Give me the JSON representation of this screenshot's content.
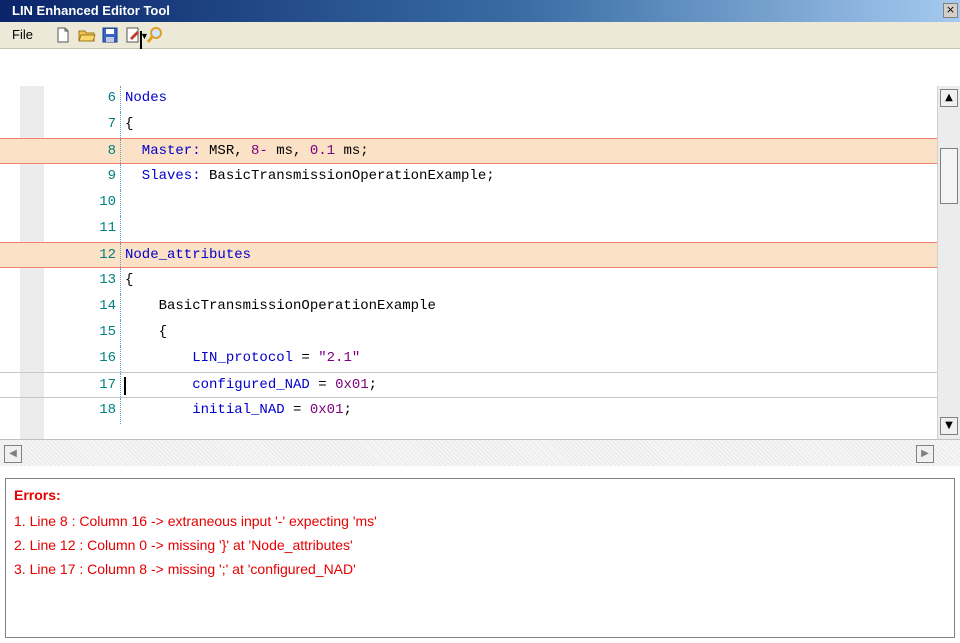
{
  "window": {
    "title": "LIN Enhanced Editor Tool",
    "close_glyph": "×"
  },
  "toolbar": {
    "file_menu": "File",
    "icons": [
      "new-file-icon",
      "open-folder-icon",
      "save-icon",
      "edit-document-icon",
      "find-icon"
    ]
  },
  "editor": {
    "lines": [
      {
        "number": "6",
        "segments": [
          {
            "text": "Nodes",
            "color": "kw"
          }
        ]
      },
      {
        "number": "7",
        "segments": [
          {
            "text": "{",
            "color": "plain"
          }
        ]
      },
      {
        "number": "8",
        "segments": [
          {
            "text": "  Master: ",
            "color": "kw"
          },
          {
            "text": "MSR, ",
            "color": "plain"
          },
          {
            "text": "8-",
            "color": "num"
          },
          {
            "text": " ms, ",
            "color": "plain"
          },
          {
            "text": "0.1",
            "color": "num"
          },
          {
            "text": " ms;",
            "color": "plain"
          }
        ],
        "highlight": true
      },
      {
        "number": "9",
        "segments": [
          {
            "text": "  Slaves: ",
            "color": "kw"
          },
          {
            "text": "BasicTransmissionOperationExample;",
            "color": "plain"
          }
        ]
      },
      {
        "number": "10",
        "segments": []
      },
      {
        "number": "11",
        "segments": []
      },
      {
        "number": "12",
        "segments": [
          {
            "text": "Node_attributes",
            "color": "kw"
          }
        ],
        "highlight": true
      },
      {
        "number": "13",
        "segments": [
          {
            "text": "{",
            "color": "plain"
          }
        ]
      },
      {
        "number": "14",
        "segments": [
          {
            "text": "    BasicTransmissionOperationExample",
            "color": "plain"
          }
        ]
      },
      {
        "number": "15",
        "segments": [
          {
            "text": "    {",
            "color": "plain"
          }
        ]
      },
      {
        "number": "16",
        "segments": [
          {
            "text": "        LIN_protocol",
            "color": "kw"
          },
          {
            "text": " = ",
            "color": "plain"
          },
          {
            "text": "\"2.1\"",
            "color": "str"
          }
        ]
      },
      {
        "number": "17",
        "segments": [
          {
            "text": "        configured_NAD",
            "color": "kw"
          },
          {
            "text": " = ",
            "color": "plain"
          },
          {
            "text": "0x01",
            "color": "num"
          },
          {
            "text": ";",
            "color": "plain"
          }
        ],
        "current": true
      },
      {
        "number": "18",
        "segments": [
          {
            "text": "        initial_NAD",
            "color": "kw"
          },
          {
            "text": " = ",
            "color": "plain"
          },
          {
            "text": "0x01",
            "color": "num"
          },
          {
            "text": ";",
            "color": "plain"
          }
        ]
      }
    ],
    "colors": {
      "kw": "#0000cc",
      "num": "#800080",
      "str": "#800080",
      "plain": "#000000"
    }
  },
  "errors": {
    "title": "Errors:",
    "items": [
      "1. Line 8 : Column 16 -> extraneous input '-' expecting 'ms'",
      "2. Line 12 : Column 0 -> missing '}' at 'Node_attributes'",
      "3. Line 17 : Column 8 -> missing ';' at 'configured_NAD'"
    ],
    "color": "#e60000"
  }
}
